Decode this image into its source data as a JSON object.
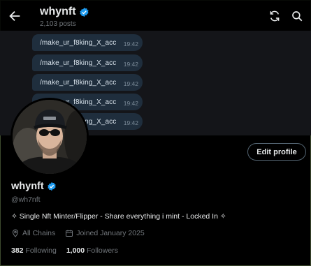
{
  "header": {
    "title": "whynft",
    "posts_count": "2,103 posts"
  },
  "banner": {
    "messages": [
      {
        "text": "/make_ur_f8king_X_acc",
        "time": "19:42"
      },
      {
        "text": "/make_ur_f8king_X_acc",
        "time": "19:42"
      },
      {
        "text": "/make_ur_f8king_X_acc",
        "time": "19:42"
      },
      {
        "text": "/make_ur_f8king_X_acc",
        "time": "19:42"
      },
      {
        "text": "/make_ur_f8king_X_acc",
        "time": "19:42"
      }
    ]
  },
  "profile": {
    "edit_label": "Edit profile",
    "name": "whynft",
    "handle": "@wh7nft",
    "bio": "✧ Single Nft Minter/Flipper - Share everything i mint - Locked In ✧",
    "location": "All Chains",
    "joined": "Joined January 2025",
    "following_count": "382",
    "following_label": "Following",
    "followers_count": "1,000",
    "followers_label": "Followers"
  },
  "colors": {
    "verified_badge": "#1d9bf0",
    "background": "#000000",
    "secondary_text": "#71767b",
    "message_bubble": "#1f2e3d"
  },
  "icons": {
    "back": "arrow-left-icon",
    "refresh": "refresh-icon",
    "search": "search-icon",
    "verified": "verified-badge-icon",
    "location": "location-pin-icon",
    "calendar": "calendar-icon"
  }
}
